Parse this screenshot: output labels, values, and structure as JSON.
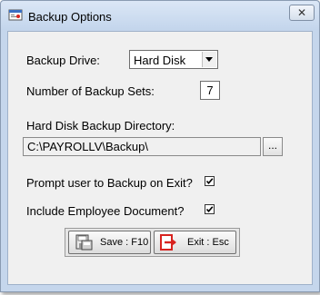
{
  "window": {
    "title": "Backup Options",
    "close_glyph": "✕"
  },
  "form": {
    "backup_drive_label": "Backup Drive:",
    "backup_drive_value": "Hard Disk",
    "backup_sets_label": "Number of Backup Sets:",
    "backup_sets_value": "7",
    "directory_label": "Hard Disk Backup Directory:",
    "directory_value": "C:\\PAYROLLV\\Backup\\",
    "browse_label": "...",
    "prompt_label": "Prompt user to Backup on Exit?",
    "prompt_checked": true,
    "include_doc_label": "Include Employee Document?",
    "include_doc_checked": true
  },
  "buttons": {
    "save_label": "Save : F10",
    "exit_label": "Exit : Esc"
  },
  "icons": {
    "app": "backup-app-icon",
    "save": "save-disk-icon",
    "exit": "exit-door-icon"
  },
  "colors": {
    "window_frame": "#c5d6ec",
    "client_bg": "#f0f0f0",
    "exit_icon_red": "#d8231f"
  }
}
